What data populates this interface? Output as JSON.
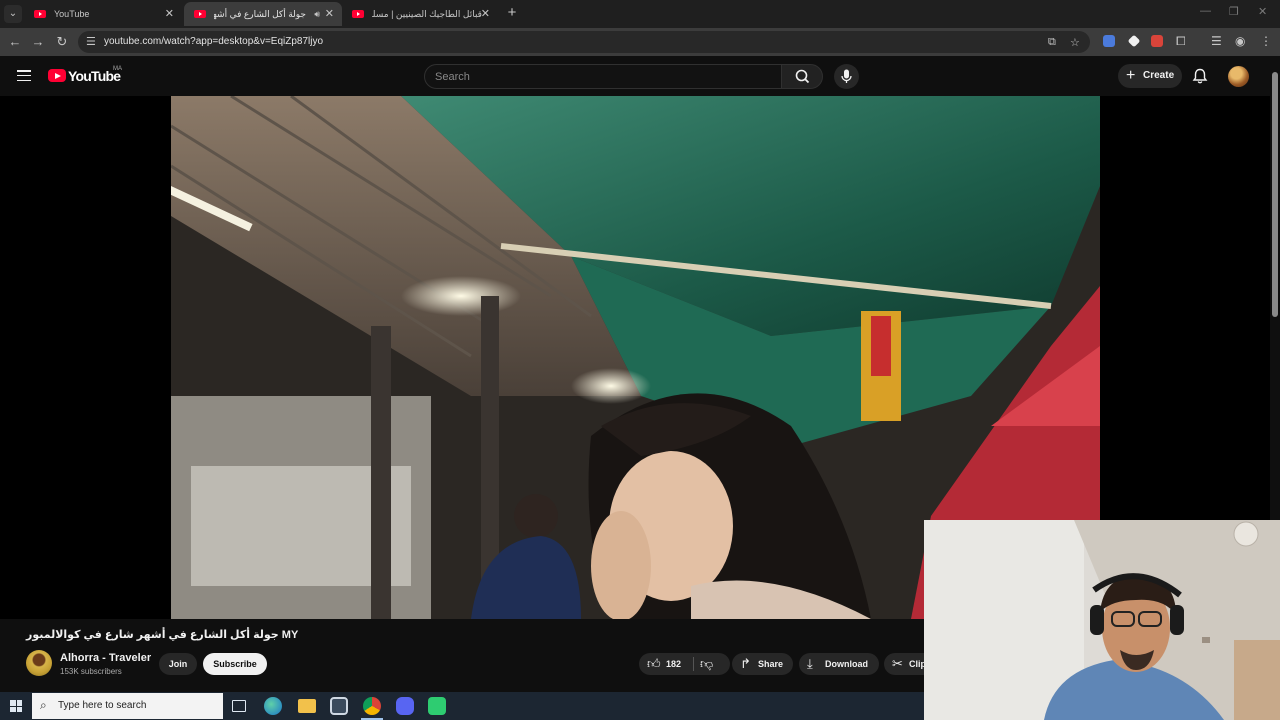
{
  "browser": {
    "tabs": [
      {
        "title": "YouTube",
        "active": false
      },
      {
        "title": "جولة أكل الشارع في أشهر شارع في كوالالمبور",
        "active": true
      },
      {
        "title": "قبائل الطاجيك الصينيين | مسلمو...",
        "active": false
      }
    ],
    "url": "youtube.com/watch?app=desktop&v=EqiZp87ljyo"
  },
  "youtube": {
    "logo_text": "YouTube",
    "country_code": "MA",
    "search_placeholder": "Search",
    "create_label": "Create"
  },
  "video": {
    "title": "جولة أكل الشارع في أشهر شارع في كوالالمبور MY",
    "channel_name": "Alhorra - Traveler",
    "subscribers": "153K subscribers",
    "join_label": "Join",
    "subscribe_label": "Subscribe",
    "like_count": "182",
    "share_label": "Share",
    "download_label": "Download",
    "clip_label": "Clip"
  },
  "taskbar": {
    "search_placeholder": "Type here to search"
  },
  "colors": {
    "yt_red": "#ff0033",
    "page_bg": "#0f0f0f",
    "chip_bg": "#272727"
  }
}
